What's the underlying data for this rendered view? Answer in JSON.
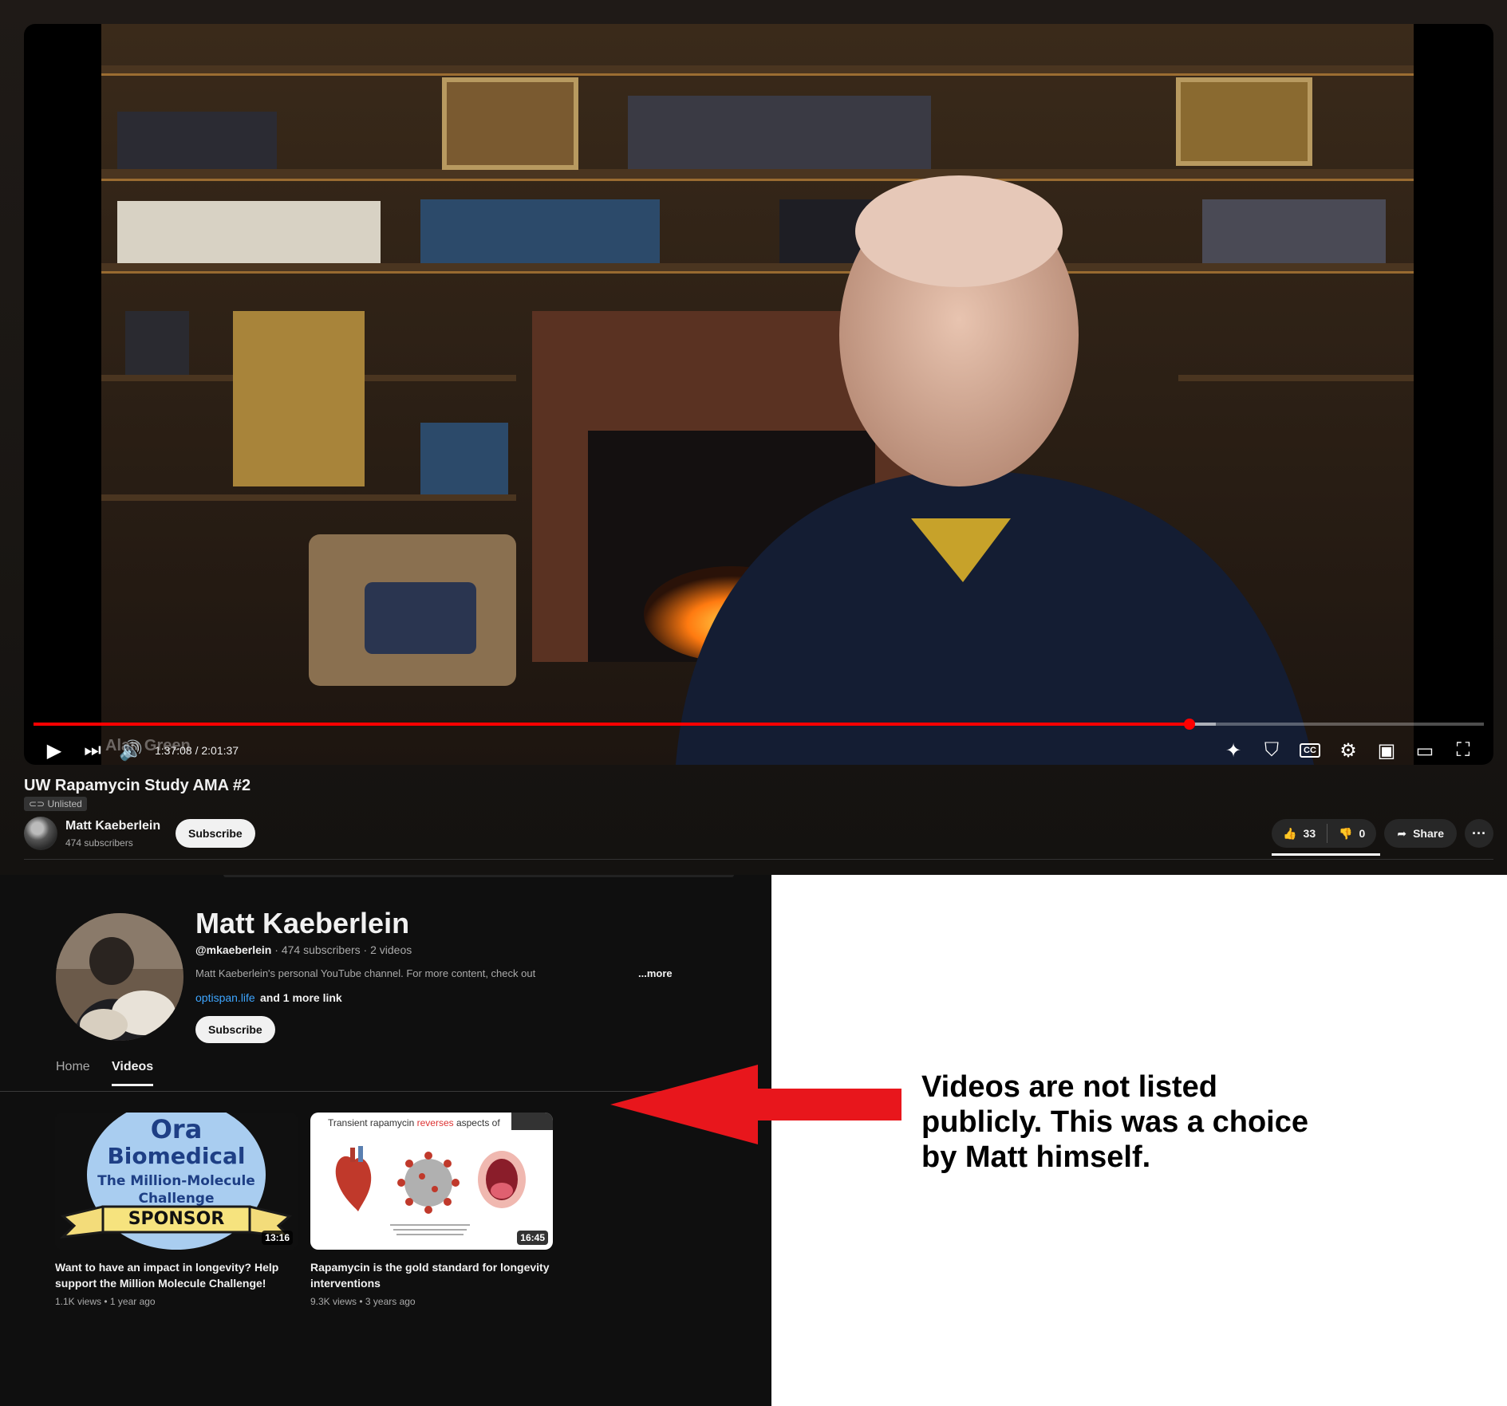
{
  "player": {
    "watermark": "Alan Green",
    "time": "1:37:08 / 2:01:37",
    "progress_fraction": 0.797,
    "buffered_fraction": 0.815
  },
  "video": {
    "title": "UW Rapamycin Study AMA #2",
    "badge": "Unlisted",
    "channel_name": "Matt Kaeberlein",
    "channel_subs": "474 subscribers",
    "subscribe_label": "Subscribe",
    "likes": "33",
    "dislikes": "0",
    "share_label": "Share",
    "more_label": "···"
  },
  "channel": {
    "name": "Matt Kaeberlein",
    "handle": "@mkaeberlein",
    "meta": " · 474 subscribers · 2 videos",
    "description": "Matt Kaeberlein's personal YouTube channel.  For more content, check out",
    "more_label": "...more",
    "link": "optispan.life",
    "more_links": "and 1 more link",
    "subscribe_label": "Subscribe",
    "tabs": [
      {
        "label": "Home"
      },
      {
        "label": "Videos"
      }
    ],
    "videos": [
      {
        "title": "Want to have an impact in longevity? Help support the Million Molecule Challenge!",
        "meta": "1.1K views • 1 year ago",
        "duration": "13:16",
        "thumb_line1": "Ora",
        "thumb_line2": "Biomedical",
        "thumb_line3": "The Million-Molecule",
        "thumb_line4": "Challenge",
        "thumb_banner": "SPONSOR"
      },
      {
        "title": "Rapamycin is the gold standard for longevity interventions",
        "meta": "9.3K views • 3 years ago",
        "duration": "16:45",
        "thumb_caption_a": "Transient rapamycin ",
        "thumb_caption_b": "reverses",
        "thumb_caption_c": " aspects of"
      }
    ]
  },
  "annotation": {
    "text": "Videos are not listed publicly. This was a choice by Matt himself.",
    "arrow_color": "#e8161c"
  }
}
